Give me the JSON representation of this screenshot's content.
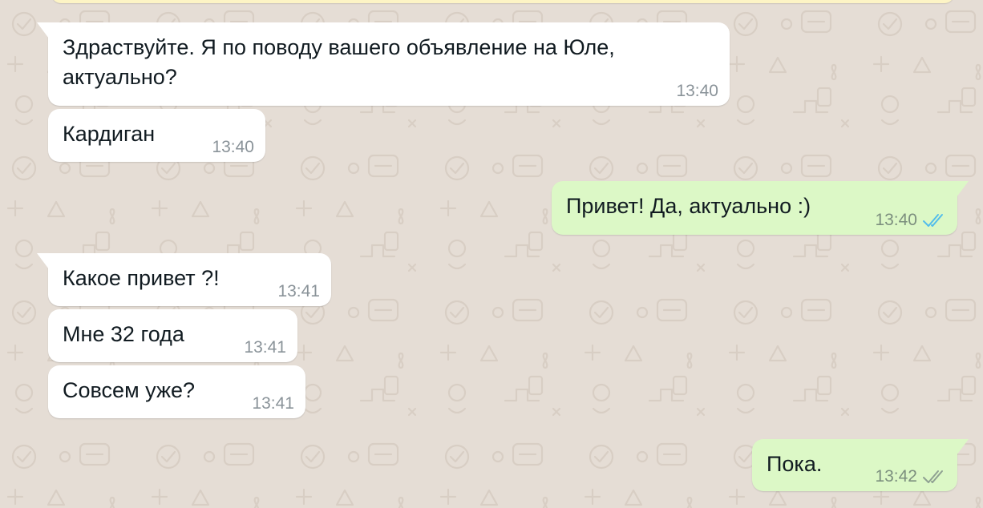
{
  "chat": {
    "messages": [
      {
        "direction": "in",
        "lines": [
          "Здраствуйте. Я по поводу вашего объявление на Юле,",
          "актуально?"
        ],
        "time": "13:40"
      },
      {
        "direction": "in",
        "lines": [
          "Кардиган"
        ],
        "time": "13:40"
      },
      {
        "direction": "out",
        "lines": [
          "Привет! Да, актуально :)"
        ],
        "time": "13:40",
        "status": "read",
        "tick_color": "#53bdeb"
      },
      {
        "direction": "in",
        "lines": [
          "Какое привет ?!"
        ],
        "time": "13:41"
      },
      {
        "direction": "in",
        "lines": [
          "Мне 32 года"
        ],
        "time": "13:41"
      },
      {
        "direction": "in",
        "lines": [
          "Совсем уже?"
        ],
        "time": "13:41"
      },
      {
        "direction": "out",
        "lines": [
          "Пока."
        ],
        "time": "13:42",
        "status": "delivered",
        "tick_color": "#8fa092"
      }
    ]
  },
  "colors": {
    "chat_background": "#e5ddd5",
    "incoming_bubble": "#ffffff",
    "outgoing_bubble": "#dcf8c6",
    "timestamp": "#8a9399",
    "read_tick": "#53bdeb",
    "delivered_tick": "#8fa092"
  }
}
